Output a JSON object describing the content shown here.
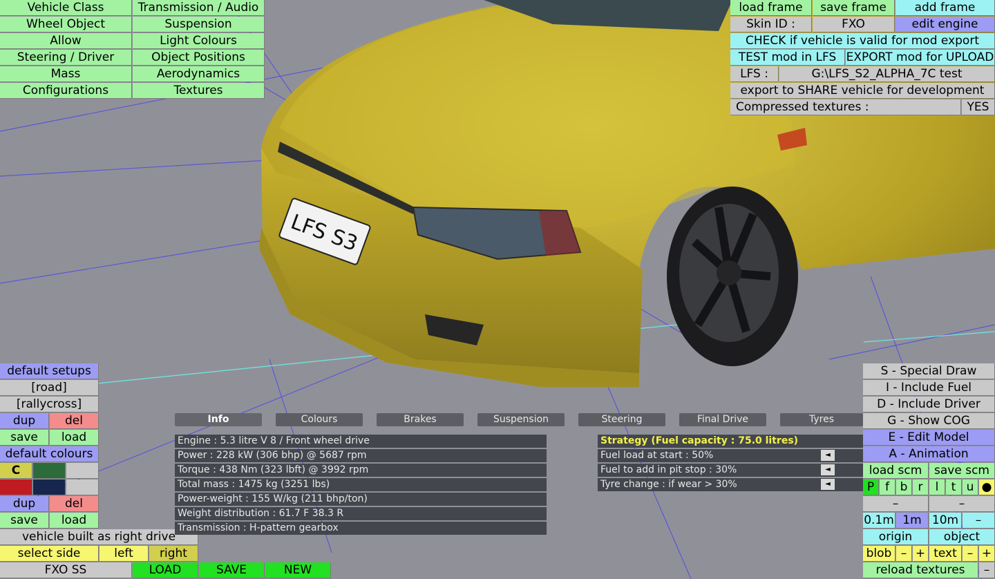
{
  "top_left_menu": [
    [
      "Vehicle Class",
      "Transmission / Audio"
    ],
    [
      "Wheel Object",
      "Suspension"
    ],
    [
      "Allow",
      "Light Colours"
    ],
    [
      "Steering / Driver",
      "Object Positions"
    ],
    [
      "Mass",
      "Aerodynamics"
    ],
    [
      "Configurations",
      "Textures"
    ]
  ],
  "top_right": {
    "load_frame": "load frame",
    "save_frame": "save frame",
    "add_frame": "add frame",
    "skin_id_label": "Skin ID :",
    "skin_id_value": "FXO",
    "edit_engine": "edit engine",
    "check": "CHECK if vehicle is valid for mod export",
    "test": "TEST mod in LFS",
    "export": "EXPORT mod for UPLOAD",
    "lfs_label": "LFS :",
    "lfs_path": "G:\\LFS_S2_ALPHA_7C test",
    "share": "export to SHARE vehicle for development",
    "compressed_label": "Compressed textures :",
    "compressed_value": "YES"
  },
  "plate_text": "LFS S3",
  "left_panel": {
    "default_setups": "default setups",
    "road": "[road]",
    "rallycross": "[rallycross]",
    "dup": "dup",
    "del": "del",
    "save": "save",
    "load": "load",
    "default_colours": "default colours",
    "c_label": "C",
    "swatches": [
      "#2c6b3a",
      "#c9c9c9",
      "#c01b22",
      "#17264e",
      "#c9c9c9"
    ],
    "right_drive": "vehicle built as right drive",
    "select_side": "select side",
    "left": "left",
    "right": "right",
    "vehicle_name": "FXO SS",
    "load_btn": "LOAD",
    "save_btn": "SAVE",
    "new_btn": "NEW"
  },
  "tabs": [
    "Info",
    "Colours",
    "Brakes",
    "Suspension",
    "Steering",
    "Final Drive",
    "Tyres"
  ],
  "active_tab": "Info",
  "info_rows": [
    "Engine : 5.3 litre V 8 / Front wheel drive",
    "Power : 228 kW (306 bhp) @ 5687 rpm",
    "Torque : 438 Nm (323 lbft) @ 3992 rpm",
    "Total mass : 1475 kg (3251 lbs)",
    "Power-weight : 155 W/kg (211 bhp/ton)",
    "Weight distribution : 61.7 F  38.3 R",
    "Transmission : H-pattern gearbox"
  ],
  "strategy": {
    "title": "Strategy (Fuel capacity : 75.0 litres)",
    "rows": [
      "Fuel load at start : 50%",
      "Fuel to add in pit stop : 30%",
      "Tyre change : if wear > 30%"
    ],
    "arrow": "◄"
  },
  "right_panel": {
    "special_draw": "S - Special Draw",
    "include_fuel": "I - Include Fuel",
    "include_driver": "D - Include Driver",
    "show_cog": "G - Show COG",
    "edit_model": "E - Edit Model",
    "animation": "A - Animation",
    "load_scm": "load scm",
    "save_scm": "save scm",
    "letters": [
      "P",
      "f",
      "b",
      "r",
      "l",
      "t",
      "u"
    ],
    "dot": "●",
    "minus": "–",
    "d01": "0.1m",
    "d1": "1m",
    "d10": "10m",
    "origin": "origin",
    "object": "object",
    "blob": "blob",
    "plus": "+",
    "text": "text",
    "reload": "reload textures"
  },
  "colors": {
    "green": "#a2f2a2",
    "bright_green": "#22e022",
    "cyan": "#9cf2f2",
    "purple": "#9c9cf4",
    "red": "#f48c8c",
    "yellow": "#f6f670",
    "grey": "#c9c9c9",
    "car_yellow": "#c9b22c"
  }
}
